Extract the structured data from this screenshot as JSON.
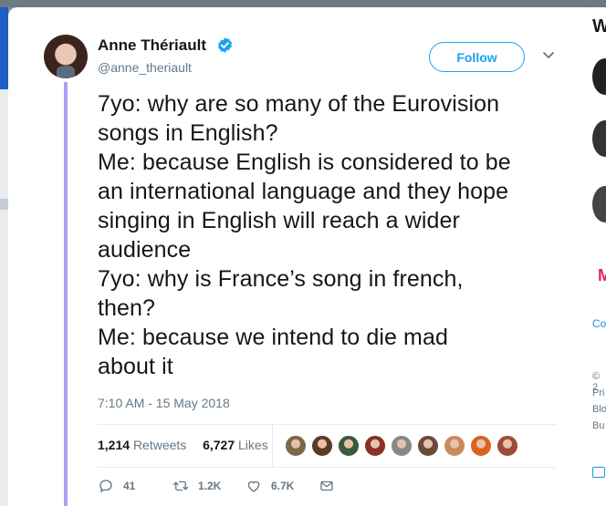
{
  "author": {
    "name": "Anne Thériault",
    "handle": "@anne_theriault",
    "verified": true
  },
  "follow_button": {
    "label": "Follow"
  },
  "tweet": {
    "lines": [
      "7yo: why are so many of the Eurovision",
      "songs in English?",
      "Me: because English is considered to be",
      "an international language and they hope",
      "singing in English will reach a wider",
      "audience",
      "7yo: why is France’s song in french,",
      "then?",
      "Me: because we intend to die mad",
      "about it"
    ],
    "timestamp": "7:10 AM - 15 May 2018"
  },
  "stats": {
    "retweets_count": "1,214",
    "retweets_label": "Retweets",
    "likes_count": "6,727",
    "likes_label": "Likes"
  },
  "liker_avatar_colors": [
    "#7a6a4a",
    "#5b3b22",
    "#3a5a3a",
    "#8a2f2a",
    "#888888",
    "#6a4a3a",
    "#c98a5a",
    "#d8641e",
    "#a04a3a"
  ],
  "actions": {
    "reply_icon": "reply-icon",
    "reply_count": "41",
    "retweet_icon": "retweet-icon",
    "retweet_count": "1.2K",
    "like_icon": "heart-icon",
    "like_count": "6.7K",
    "message_icon": "envelope-icon"
  },
  "right_panel": {
    "heading_fragment": "W",
    "red_fragment": "M",
    "link_fragment": "Co",
    "footer_fragments": [
      "© 2",
      "Pri",
      "Blo",
      "Bu"
    ]
  },
  "colors": {
    "accent": "#1da1f2",
    "thread_line": "#ab9ff2",
    "muted_text": "#657786"
  }
}
